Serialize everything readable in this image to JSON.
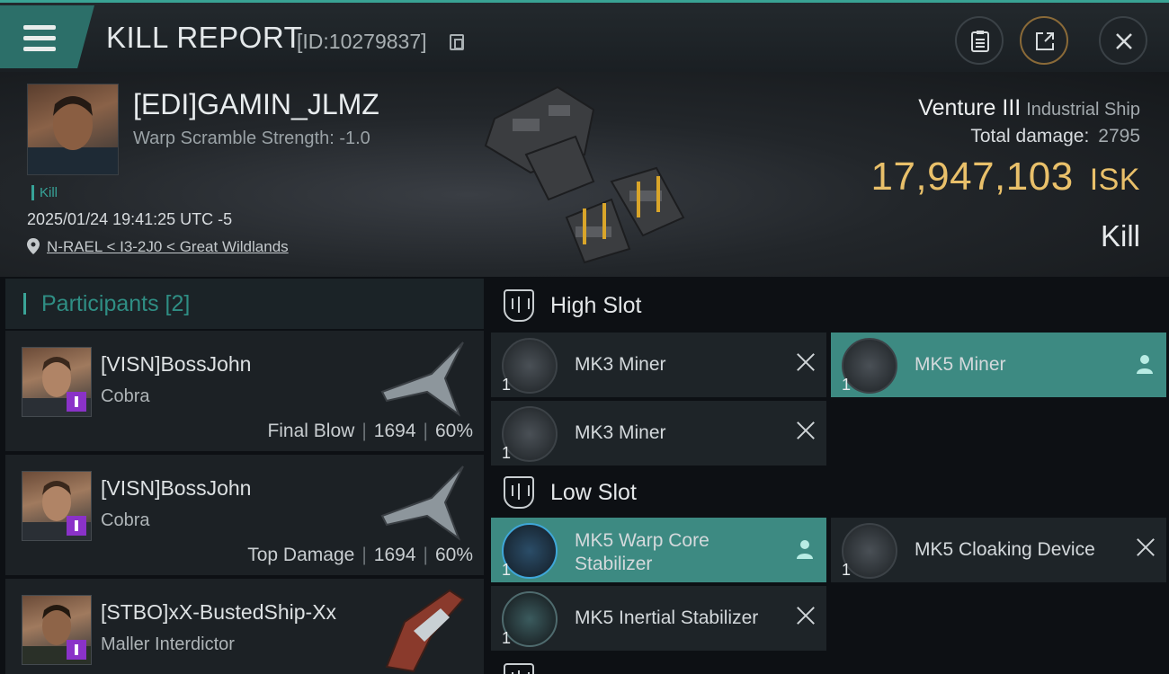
{
  "header": {
    "title": "KILL REPORT",
    "report_id": "[ID:10279837]"
  },
  "victim": {
    "name": "[EDI]GAMIN_JLMZ",
    "warp_scramble": "Warp Scramble Strength: -1.0",
    "tag": "Kill",
    "datetime": "2025/01/24 19:41:25 UTC -5",
    "location": "N-RAEL < I3-2J0 < Great Wildlands"
  },
  "ship": {
    "name": "Venture III",
    "class": "Industrial Ship",
    "total_damage_label": "Total damage:",
    "total_damage": "2795",
    "isk_value": "17,947,103",
    "isk_unit": "ISK",
    "result": "Kill"
  },
  "participants": {
    "title": "Participants [2]",
    "items": [
      {
        "name": "[VISN]BossJohn",
        "ship": "Cobra",
        "role": "Final Blow",
        "damage": "1694",
        "percent": "60%"
      },
      {
        "name": "[VISN]BossJohn",
        "ship": "Cobra",
        "role": "Top Damage",
        "damage": "1694",
        "percent": "60%"
      },
      {
        "name": "[STBO]xX-BustedShip-Xx",
        "ship": "Maller Interdictor"
      }
    ]
  },
  "slots": {
    "high": {
      "title": "High Slot",
      "modules": [
        {
          "name": "MK3 Miner",
          "qty": "1"
        },
        {
          "name": "MK5 Miner",
          "qty": "1"
        },
        {
          "name": "MK3 Miner",
          "qty": "1"
        }
      ]
    },
    "low": {
      "title": "Low Slot",
      "modules": [
        {
          "name": "MK5 Warp Core Stabilizer",
          "qty": "1"
        },
        {
          "name": "MK5 Cloaking Device",
          "qty": "1"
        },
        {
          "name": "MK5 Inertial Stabilizer",
          "qty": "1"
        }
      ]
    }
  },
  "colors": {
    "accent": "#39a394",
    "isk": "#e9c06a",
    "highlight": "#3d8a82"
  }
}
